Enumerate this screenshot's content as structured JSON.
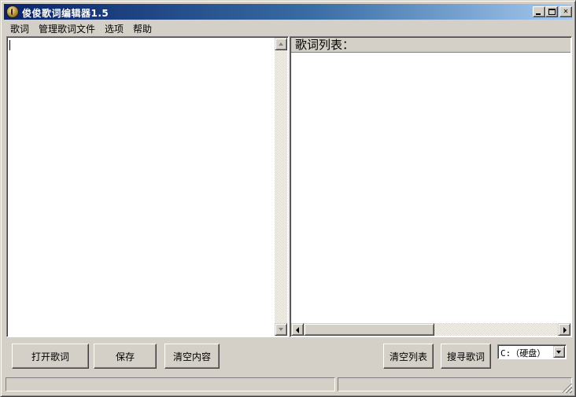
{
  "window": {
    "title": "俊俊歌词编辑器1.5",
    "controls": {
      "minimize": "_",
      "maximize": "□",
      "close": "✕"
    },
    "accent_color": "#0a246a"
  },
  "menu": {
    "items": [
      {
        "label": "歌词"
      },
      {
        "label": "管理歌词文件"
      },
      {
        "label": "选项"
      },
      {
        "label": "帮助"
      }
    ]
  },
  "editor": {
    "text": ""
  },
  "lyrics_list": {
    "header": "歌词列表：",
    "items": []
  },
  "buttons": {
    "open_lyrics": "打开歌词",
    "save": "保存",
    "clear_content": "清空内容",
    "clear_list": "清空列表",
    "search_lyrics": "搜寻歌词"
  },
  "drive": {
    "selected": "C:（硬盘）"
  },
  "status": {
    "pane1": "",
    "pane2": ""
  }
}
